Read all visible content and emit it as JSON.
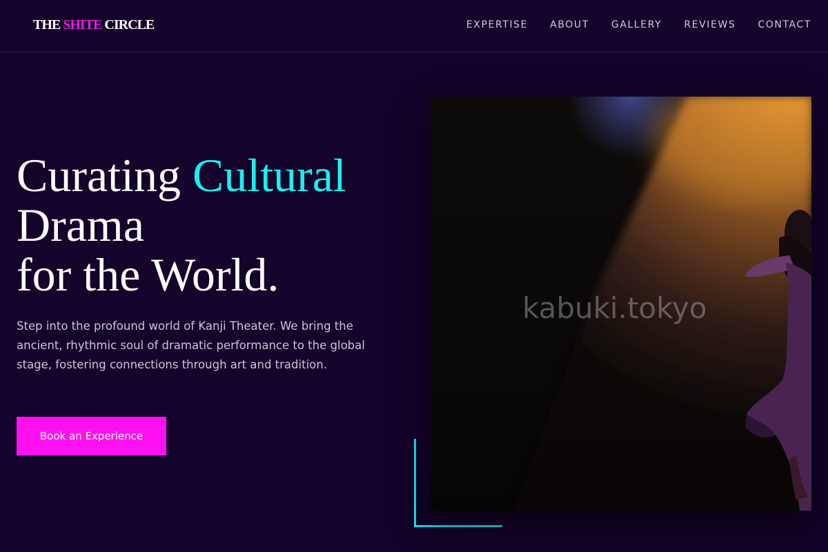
{
  "brand": {
    "part1": "THE ",
    "accent": "SHITE",
    "part2": " CIRCLE"
  },
  "nav": {
    "expertise": "EXPERTISE",
    "about": "ABOUT",
    "gallery": "GALLERY",
    "reviews": "REVIEWS",
    "contact": "CONTACT"
  },
  "hero": {
    "title_part1": "Curating ",
    "title_accent": "Cultural",
    "title_line2": "Drama",
    "title_line3": "for the World.",
    "description": "Step into the profound world of Kanji Theater. We bring the ancient, rhythmic soul of dramatic performance to the global stage, fostering connections through art and tradition.",
    "cta_label": "Book an Experience"
  },
  "image": {
    "watermark": "kabuki.tokyo"
  },
  "colors": {
    "background": "#14032a",
    "accent_pink": "#ff10f0",
    "accent_cyan": "#19f0f0",
    "logo_accent": "#e21ee0"
  }
}
